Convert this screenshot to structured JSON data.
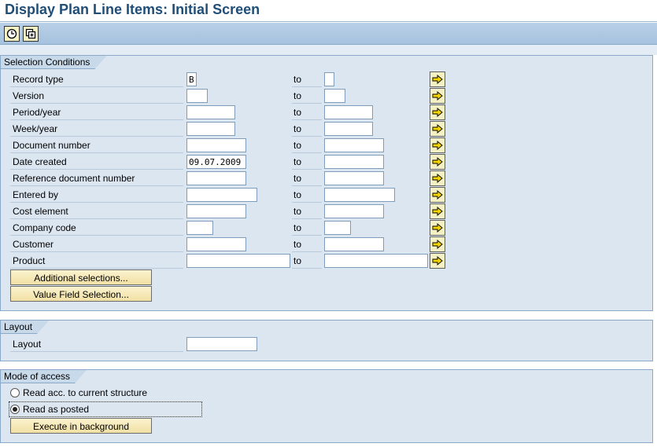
{
  "window": {
    "title": "Display Plan Line Items: Initial Screen"
  },
  "toolbar": {
    "buttons": [
      {
        "icon": "execute-clock-icon"
      },
      {
        "icon": "selection-options-icon"
      }
    ]
  },
  "selection": {
    "tab_label": "Selection Conditions",
    "to_label": "to",
    "rows": [
      {
        "label": "Record type",
        "from": "B",
        "to": ""
      },
      {
        "label": "Version",
        "from": "",
        "to": ""
      },
      {
        "label": "Period/year",
        "from": "",
        "to": ""
      },
      {
        "label": "Week/year",
        "from": "",
        "to": ""
      },
      {
        "label": "Document number",
        "from": "",
        "to": ""
      },
      {
        "label": "Date created",
        "from": "09.07.2009",
        "to": ""
      },
      {
        "label": "Reference document number",
        "from": "",
        "to": ""
      },
      {
        "label": "Entered by",
        "from": "",
        "to": ""
      },
      {
        "label": "Cost element",
        "from": "",
        "to": ""
      },
      {
        "label": "Company code",
        "from": "",
        "to": ""
      },
      {
        "label": "Customer",
        "from": "",
        "to": ""
      },
      {
        "label": "Product",
        "from": "",
        "to": ""
      }
    ],
    "additional_button": "Additional selections...",
    "value_field_button": "Value Field Selection..."
  },
  "layout": {
    "tab_label": "Layout",
    "field_label": "Layout",
    "value": ""
  },
  "access": {
    "tab_label": "Mode of access",
    "option_current": "Read acc. to current structure",
    "option_posted": "Read as posted",
    "selected": "Read as posted",
    "execute_button": "Execute in background"
  },
  "colors": {
    "title": "#1f4e79",
    "frame_bg": "#dbe6f1",
    "button_bg": "#f3f0c3"
  }
}
